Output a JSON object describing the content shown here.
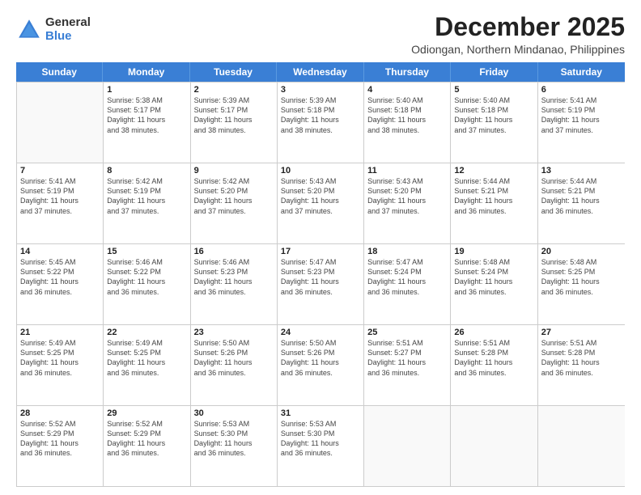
{
  "logo": {
    "general": "General",
    "blue": "Blue"
  },
  "header": {
    "title": "December 2025",
    "subtitle": "Odiongan, Northern Mindanao, Philippines"
  },
  "weekdays": [
    "Sunday",
    "Monday",
    "Tuesday",
    "Wednesday",
    "Thursday",
    "Friday",
    "Saturday"
  ],
  "weeks": [
    [
      {
        "day": "",
        "detail": ""
      },
      {
        "day": "1",
        "detail": "Sunrise: 5:38 AM\nSunset: 5:17 PM\nDaylight: 11 hours\nand 38 minutes."
      },
      {
        "day": "2",
        "detail": "Sunrise: 5:39 AM\nSunset: 5:17 PM\nDaylight: 11 hours\nand 38 minutes."
      },
      {
        "day": "3",
        "detail": "Sunrise: 5:39 AM\nSunset: 5:18 PM\nDaylight: 11 hours\nand 38 minutes."
      },
      {
        "day": "4",
        "detail": "Sunrise: 5:40 AM\nSunset: 5:18 PM\nDaylight: 11 hours\nand 38 minutes."
      },
      {
        "day": "5",
        "detail": "Sunrise: 5:40 AM\nSunset: 5:18 PM\nDaylight: 11 hours\nand 37 minutes."
      },
      {
        "day": "6",
        "detail": "Sunrise: 5:41 AM\nSunset: 5:19 PM\nDaylight: 11 hours\nand 37 minutes."
      }
    ],
    [
      {
        "day": "7",
        "detail": "Sunrise: 5:41 AM\nSunset: 5:19 PM\nDaylight: 11 hours\nand 37 minutes."
      },
      {
        "day": "8",
        "detail": "Sunrise: 5:42 AM\nSunset: 5:19 PM\nDaylight: 11 hours\nand 37 minutes."
      },
      {
        "day": "9",
        "detail": "Sunrise: 5:42 AM\nSunset: 5:20 PM\nDaylight: 11 hours\nand 37 minutes."
      },
      {
        "day": "10",
        "detail": "Sunrise: 5:43 AM\nSunset: 5:20 PM\nDaylight: 11 hours\nand 37 minutes."
      },
      {
        "day": "11",
        "detail": "Sunrise: 5:43 AM\nSunset: 5:20 PM\nDaylight: 11 hours\nand 37 minutes."
      },
      {
        "day": "12",
        "detail": "Sunrise: 5:44 AM\nSunset: 5:21 PM\nDaylight: 11 hours\nand 36 minutes."
      },
      {
        "day": "13",
        "detail": "Sunrise: 5:44 AM\nSunset: 5:21 PM\nDaylight: 11 hours\nand 36 minutes."
      }
    ],
    [
      {
        "day": "14",
        "detail": "Sunrise: 5:45 AM\nSunset: 5:22 PM\nDaylight: 11 hours\nand 36 minutes."
      },
      {
        "day": "15",
        "detail": "Sunrise: 5:46 AM\nSunset: 5:22 PM\nDaylight: 11 hours\nand 36 minutes."
      },
      {
        "day": "16",
        "detail": "Sunrise: 5:46 AM\nSunset: 5:23 PM\nDaylight: 11 hours\nand 36 minutes."
      },
      {
        "day": "17",
        "detail": "Sunrise: 5:47 AM\nSunset: 5:23 PM\nDaylight: 11 hours\nand 36 minutes."
      },
      {
        "day": "18",
        "detail": "Sunrise: 5:47 AM\nSunset: 5:24 PM\nDaylight: 11 hours\nand 36 minutes."
      },
      {
        "day": "19",
        "detail": "Sunrise: 5:48 AM\nSunset: 5:24 PM\nDaylight: 11 hours\nand 36 minutes."
      },
      {
        "day": "20",
        "detail": "Sunrise: 5:48 AM\nSunset: 5:25 PM\nDaylight: 11 hours\nand 36 minutes."
      }
    ],
    [
      {
        "day": "21",
        "detail": "Sunrise: 5:49 AM\nSunset: 5:25 PM\nDaylight: 11 hours\nand 36 minutes."
      },
      {
        "day": "22",
        "detail": "Sunrise: 5:49 AM\nSunset: 5:25 PM\nDaylight: 11 hours\nand 36 minutes."
      },
      {
        "day": "23",
        "detail": "Sunrise: 5:50 AM\nSunset: 5:26 PM\nDaylight: 11 hours\nand 36 minutes."
      },
      {
        "day": "24",
        "detail": "Sunrise: 5:50 AM\nSunset: 5:26 PM\nDaylight: 11 hours\nand 36 minutes."
      },
      {
        "day": "25",
        "detail": "Sunrise: 5:51 AM\nSunset: 5:27 PM\nDaylight: 11 hours\nand 36 minutes."
      },
      {
        "day": "26",
        "detail": "Sunrise: 5:51 AM\nSunset: 5:28 PM\nDaylight: 11 hours\nand 36 minutes."
      },
      {
        "day": "27",
        "detail": "Sunrise: 5:51 AM\nSunset: 5:28 PM\nDaylight: 11 hours\nand 36 minutes."
      }
    ],
    [
      {
        "day": "28",
        "detail": "Sunrise: 5:52 AM\nSunset: 5:29 PM\nDaylight: 11 hours\nand 36 minutes."
      },
      {
        "day": "29",
        "detail": "Sunrise: 5:52 AM\nSunset: 5:29 PM\nDaylight: 11 hours\nand 36 minutes."
      },
      {
        "day": "30",
        "detail": "Sunrise: 5:53 AM\nSunset: 5:30 PM\nDaylight: 11 hours\nand 36 minutes."
      },
      {
        "day": "31",
        "detail": "Sunrise: 5:53 AM\nSunset: 5:30 PM\nDaylight: 11 hours\nand 36 minutes."
      },
      {
        "day": "",
        "detail": ""
      },
      {
        "day": "",
        "detail": ""
      },
      {
        "day": "",
        "detail": ""
      }
    ]
  ]
}
